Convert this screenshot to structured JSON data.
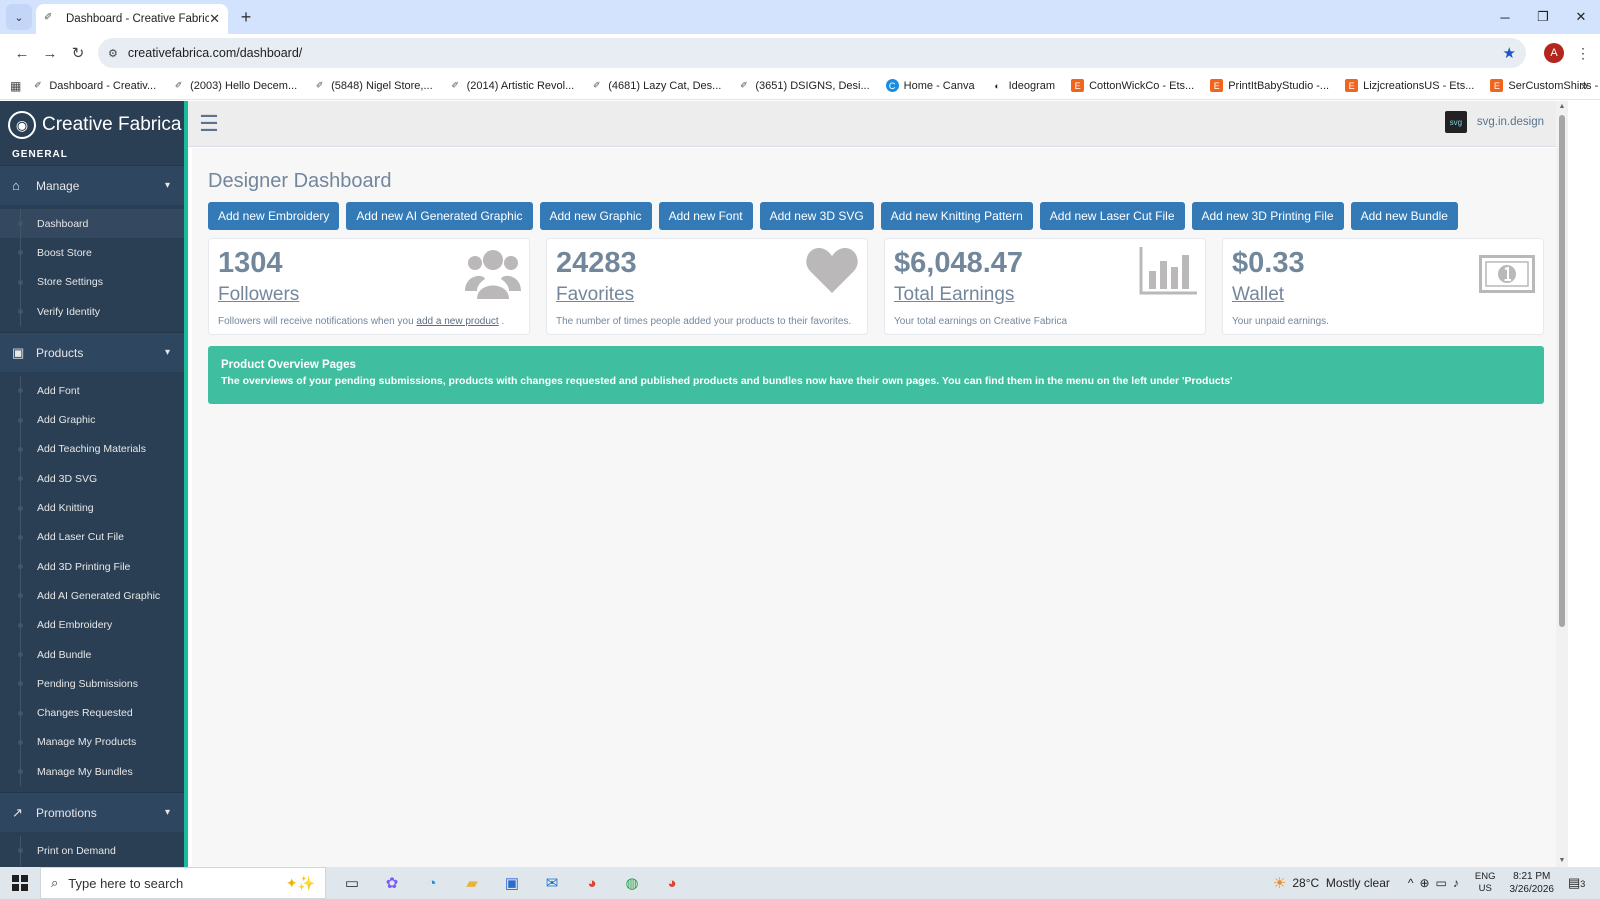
{
  "browser": {
    "tab_title": "Dashboard - Creative Fabrica",
    "url": "creativefabrica.com/dashboard/",
    "profile_initial": "A",
    "bookmarks": [
      {
        "label": "Dashboard - Creativ...",
        "icon": "cf"
      },
      {
        "label": "(2003) Hello Decem...",
        "icon": "cf"
      },
      {
        "label": "(5848) Nigel Store,...",
        "icon": "cf"
      },
      {
        "label": "(2014) Artistic Revol...",
        "icon": "cf"
      },
      {
        "label": "(4681) Lazy Cat, Des...",
        "icon": "cf"
      },
      {
        "label": "(3651) DSIGNS, Desi...",
        "icon": "cf"
      },
      {
        "label": "Home - Canva",
        "icon": "canva"
      },
      {
        "label": "Ideogram",
        "icon": "ideogram"
      },
      {
        "label": "CottonWickCo - Ets...",
        "icon": "etsy"
      },
      {
        "label": "PrintItBabyStudio -...",
        "icon": "etsy"
      },
      {
        "label": "LizjcreationsUS - Ets...",
        "icon": "etsy"
      },
      {
        "label": "SerCustomShirts - E...",
        "icon": "etsy"
      }
    ]
  },
  "sidebar": {
    "brand": "Creative Fabrica",
    "section": "GENERAL",
    "manage": {
      "label": "Manage",
      "items": [
        "Dashboard",
        "Boost Store",
        "Store Settings",
        "Verify Identity"
      ]
    },
    "products": {
      "label": "Products",
      "items": [
        "Add Font",
        "Add Graphic",
        "Add Teaching Materials",
        "Add 3D SVG",
        "Add Knitting",
        "Add Laser Cut File",
        "Add 3D Printing File",
        "Add AI Generated Graphic",
        "Add Embroidery",
        "Add Bundle",
        "Pending Submissions",
        "Changes Requested",
        "Manage My Products",
        "Manage My Bundles"
      ]
    },
    "promotions": {
      "label": "Promotions",
      "items": [
        "Print on Demand"
      ]
    }
  },
  "topbar": {
    "username": "svg.in.design"
  },
  "main": {
    "title": "Designer Dashboard",
    "buttons": [
      "Add new Embroidery",
      "Add new AI Generated Graphic",
      "Add new Graphic",
      "Add new Font",
      "Add new 3D SVG",
      "Add new Knitting Pattern",
      "Add new Laser Cut File",
      "Add new 3D Printing File",
      "Add new Bundle"
    ],
    "stats": {
      "followers": {
        "value": "1304",
        "label": "Followers",
        "desc_pre": "Followers will receive notifications when you ",
        "desc_link": "add a new product",
        "desc_post": " ."
      },
      "favorites": {
        "value": "24283",
        "label": "Favorites",
        "desc": "The number of times people added your products to their favorites."
      },
      "earnings": {
        "value": "$6,048.47",
        "label": "Total Earnings",
        "desc": "Your total earnings on Creative Fabrica"
      },
      "wallet": {
        "value": "$0.33",
        "label": "Wallet",
        "desc": "Your unpaid earnings."
      }
    },
    "alert": {
      "title": "Product Overview Pages",
      "text": "The overviews of your pending submissions, products with changes requested and published products and bundles now have their own pages. You can find them in the menu on the left under 'Products'"
    }
  },
  "taskbar": {
    "search_placeholder": "Type here to search",
    "temperature": "28°C",
    "weather": "Mostly clear",
    "lang_1": "ENG",
    "lang_2": "US",
    "time": "8:21 PM",
    "date": "3/26/2026",
    "notifications": "3"
  },
  "colors": {
    "sidebar_bg": "#2a3f54",
    "accent_green": "#1abb9c",
    "button_blue": "#337ab7",
    "alert_green": "#3fbfa0",
    "text_muted": "#73879c"
  }
}
